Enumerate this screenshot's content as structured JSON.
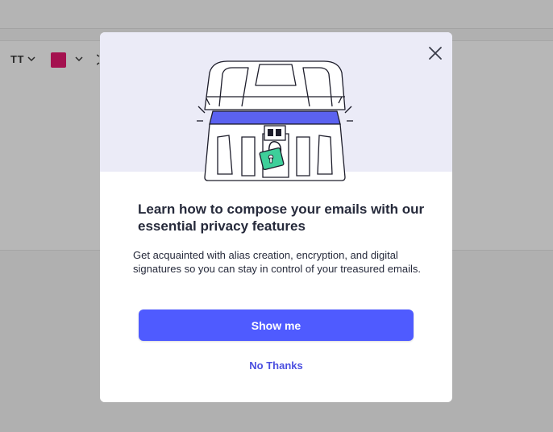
{
  "toolbar": {
    "text_style_label": "TT",
    "text_style_icon": "chevron-down-icon",
    "text_color": "#a4114f",
    "text_color_icon": "chevron-down-icon"
  },
  "modal": {
    "close_icon": "close-icon",
    "illustration": "treasure-chest-padlock-illustration",
    "hero_color": "#ebebf7",
    "title": "Learn how to compose your emails with our essential privacy features",
    "description": "Get acquainted with alias creation, encryption, and digital signatures so you can stay in control of your treasured emails.",
    "primary_button": "Show me",
    "secondary_button": "No Thanks",
    "accent_color": "#4f5bff"
  }
}
